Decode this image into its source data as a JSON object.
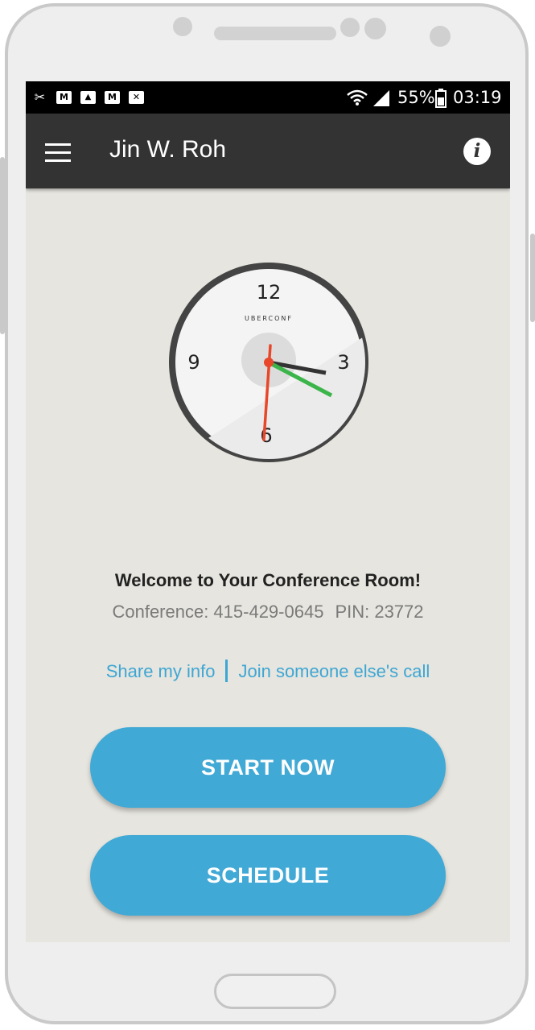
{
  "status_bar": {
    "notification_icons": [
      "tools-icon",
      "gmail-icon",
      "image-icon",
      "gmail-icon",
      "email-icon"
    ],
    "battery": "55%",
    "time": "03:19"
  },
  "app_bar": {
    "title": "Jin W. Roh",
    "info_glyph": "i"
  },
  "clock": {
    "brand": "UBERCONF",
    "numerals": [
      "12",
      "3",
      "6",
      "9"
    ],
    "hour_hand_color": "#333333",
    "minute_hand_color": "#3bb54a",
    "second_hand_color": "#e8472a"
  },
  "welcome": {
    "heading": "Welcome to Your Conference Room!",
    "conference_label": "Conference: 415-429-0645",
    "pin_label": "PIN: 23772"
  },
  "links": {
    "share": "Share my info",
    "join": "Join someone else's call"
  },
  "buttons": {
    "start": "START NOW",
    "schedule": "SCHEDULE"
  },
  "colors": {
    "accent": "#41a9d5",
    "appbar": "#333333",
    "background": "#e6e5df"
  }
}
